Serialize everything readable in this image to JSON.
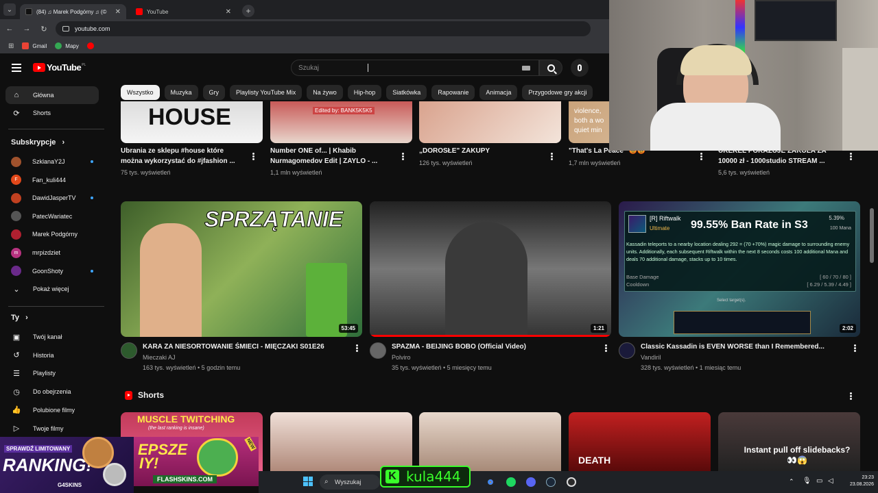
{
  "browser": {
    "tabs": [
      {
        "label": "(84) ♫ Marek Podgórny ♫ (©",
        "fav_color": "#111111",
        "active": true
      },
      {
        "label": "YouTube",
        "fav_color": "#ff0000",
        "active": false
      }
    ],
    "url": "youtube.com",
    "bookmarks": [
      {
        "label": "Gmail",
        "color": "#ea4335"
      },
      {
        "label": "Mapy",
        "color": "#34a853"
      },
      {
        "label": "",
        "color": "#ff0000"
      }
    ]
  },
  "header": {
    "logo_text": "YouTube",
    "logo_country": "PL",
    "search_placeholder": "Szukaj"
  },
  "chips": [
    "Wszystko",
    "Muzyka",
    "Gry",
    "Playlisty YouTube Mix",
    "Na żywo",
    "Hip-hop",
    "Siatkówka",
    "Rapowanie",
    "Animacja",
    "Przygodowe gry akcji"
  ],
  "sidebar": {
    "main": [
      {
        "label": "Główna",
        "icon": "home-icon",
        "glyph": "⌂"
      },
      {
        "label": "Shorts",
        "icon": "shorts-icon",
        "glyph": "⟳"
      }
    ],
    "subscriptions_title": "Subskrypcje",
    "subscriptions": [
      {
        "label": "SzklanaY2J",
        "color": "#a0522d",
        "new": true
      },
      {
        "label": "Fan_kuli444",
        "color": "#e2481a",
        "initial": "F",
        "new": false
      },
      {
        "label": "DawidJasperTV",
        "color": "#c04020",
        "new": true
      },
      {
        "label": "PatecWariatec",
        "color": "#555555",
        "new": false
      },
      {
        "label": "Marek Podgórny",
        "color": "#b02030",
        "new": false
      },
      {
        "label": "mrpizdziet",
        "color": "#b83280",
        "initial": "m",
        "new": false
      },
      {
        "label": "GoonShoty",
        "color": "#6a2a8a",
        "new": true
      },
      {
        "label": "Pokaż więcej",
        "color": "",
        "new": false
      }
    ],
    "you_title": "Ty",
    "you": [
      {
        "label": "Twój kanał",
        "glyph": "▣"
      },
      {
        "label": "Historia",
        "glyph": "↺"
      },
      {
        "label": "Playlisty",
        "glyph": "☰"
      },
      {
        "label": "Do obejrzenia",
        "glyph": "◷"
      },
      {
        "label": "Polubione filmy",
        "glyph": "👍"
      },
      {
        "label": "Twoje filmy",
        "glyph": "▷"
      }
    ]
  },
  "top_row": [
    {
      "title1": "Ubrania ze sklepu #house które",
      "title2": "można wykorzystać do #jfashion ...",
      "stats": "75 tys. wyświetleń",
      "thumb_text": "HOUSE"
    },
    {
      "title1": "Number ONE of... | Khabib",
      "title2": "Nurmagomedov Edit | ZAYLO - ...",
      "stats": "1,1 mln wyświetleń",
      "thumb_text": "Edited by: BANK5K5K5"
    },
    {
      "title1": "„DOROSŁE\" ZAKUPY",
      "title2": "",
      "stats": "126 tys. wyświetleń",
      "thumb_text": ""
    },
    {
      "title1": "\"That's La Peace\" 😡😡",
      "title2": "",
      "stats": "1,7 mln wyświetleń",
      "thumb_text": "violence, both a wo quiet min"
    },
    {
      "title1": "UKEKEL POKAZUJE ZAKULA ZA",
      "title2": "10000 zł - 1000studio STREAM ...",
      "stats": "5,6 tys. wyświetleń",
      "thumb_text": ""
    }
  ],
  "videos": [
    {
      "title": "KARA ZA NIESORTOWANIE ŚMIECI - MIĘCZAKI S01E26",
      "channel": "Mieczaki AJ",
      "stats": "163 tys. wyświetleń • 5 godzin temu",
      "duration": "53:45",
      "thumb_text": "SPRZĄTANIE",
      "avatar_color": "#2d5a2d"
    },
    {
      "title": "SPAZMA -  BEIJING BOBO (Official Video)",
      "channel": "Polviro",
      "stats": "35 tys. wyświetleń • 5 miesięcy temu",
      "duration": "1:21",
      "thumb_text": "",
      "avatar_color": "#666666"
    },
    {
      "title": "Classic Kassadin is EVEN WORSE than I Remembered...",
      "channel": "Vandiril",
      "stats": "328 tys. wyświetleń • 1 miesiąc temu",
      "duration": "2:02",
      "thumb_text": "99.55% Ban Rate in S3",
      "avatar_color": "#1a1a3a"
    }
  ],
  "kassadin": {
    "ability_key": "[R] Riftwalk",
    "ability_type": "Ultimate",
    "ability_pct": "5.39%",
    "ability_mana": "100 Mana",
    "desc": "Kassadin teleports to a nearby location dealing 292 = (70 +70%) magic damage to surrounding enemy units. Additionally, each subsequent Riftwalk within the next 8 seconds costs 100 additional Mana and deals 70 additional damage, stacks up to 10 times.",
    "base_damage_label": "Base Damage",
    "base_damage_values": "[ 60 / 70 / 80 ]",
    "cooldown_label": "Cooldown",
    "cooldown_values": "[ 6.29 / 5.39 / 4.49 ]",
    "select_target": "Select target(s)."
  },
  "shorts": {
    "title": "Shorts",
    "items": [
      {
        "text": "MUSCLE TWITCHING",
        "subtext": "(the last ranking is insane)"
      },
      {
        "text": "",
        "subtext": ""
      },
      {
        "text": "",
        "subtext": ""
      },
      {
        "text": "DEATH",
        "subtext": ""
      },
      {
        "text": "Instant pull off slidebacks? 👀😱",
        "subtext": ""
      }
    ]
  },
  "overlays": {
    "promo_line1": "SPRAWDŹ LIMITOWANY",
    "promo_line2": "RANKING!",
    "promo_brand": "G4SKINS",
    "flash_text1": "EPSZE",
    "flash_text2": "IY!",
    "flash_brand": "FLASHSKINS.COM",
    "flash_badge": "NEW",
    "streamer": "kula444",
    "streamer_initial": "K"
  },
  "taskbar": {
    "search_placeholder": "Wyszukaj",
    "time": "23:23",
    "date": "23.08.2026"
  }
}
